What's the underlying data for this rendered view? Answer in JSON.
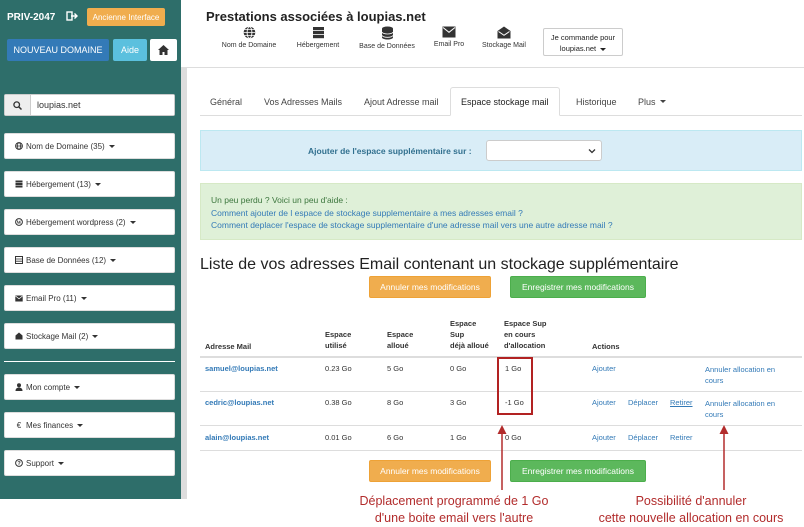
{
  "sidebar": {
    "priv_label": "PRIV-2047",
    "ancienne_label": "Ancienne Interface",
    "nouveau_label": "NOUVEAU DOMAINE",
    "aide_label": "Aide",
    "search_value": "loupias.net",
    "items": [
      {
        "label": "Nom de Domaine (35)",
        "icon": "globe-icon"
      },
      {
        "label": "Hébergement (13)",
        "icon": "server-icon"
      },
      {
        "label": "Hébergement wordpress (2)",
        "icon": "wordpress-icon"
      },
      {
        "label": "Base de Données (12)",
        "icon": "database-icon"
      },
      {
        "label": "Email Pro (11)",
        "icon": "envelope-icon"
      },
      {
        "label": "Stockage Mail (2)",
        "icon": "mail-storage-icon"
      },
      {
        "label": "Mon compte",
        "icon": "user-icon"
      },
      {
        "label": "Mes finances",
        "icon": "euro-icon"
      },
      {
        "label": "Support",
        "icon": "question-icon"
      }
    ]
  },
  "header": {
    "title": "Prestations associées à loupias.net",
    "nav": [
      {
        "label": "Nom de Domaine",
        "icon": "globe-icon"
      },
      {
        "label": "Hébergement",
        "icon": "server-icon"
      },
      {
        "label": "Base de Données",
        "icon": "database-icon"
      },
      {
        "label": "Email Pro",
        "icon": "envelope-icon"
      },
      {
        "label": "Stockage Mail",
        "icon": "mail-storage-icon"
      }
    ],
    "commande_line1": "Je commande pour",
    "commande_line2": "loupias.net"
  },
  "tabs": [
    "Général",
    "Vos Adresses Mails",
    "Ajout Adresse mail",
    "Espace stockage mail",
    "Historique",
    "Plus"
  ],
  "active_tab": "Espace stockage mail",
  "espace": {
    "label": "Ajouter de l'espace supplémentaire sur :",
    "selected": ""
  },
  "aide": {
    "intro": "Un peu perdu ? Voici un peu d'aide :",
    "link1": "Comment ajouter de l espace de stockage supplementaire a mes adresses email ?",
    "link2": "Comment deplacer l'espace de stockage supplementaire d'une adresse mail vers une autre adresse mail ?"
  },
  "list_title": "Liste de vos adresses Email contenant un stockage supplémentaire",
  "buttons": {
    "annuler": "Annuler mes modifications",
    "enregistrer": "Enregistrer mes modifications"
  },
  "table": {
    "headers": {
      "adresse": "Adresse Mail",
      "utilise": [
        "Espace",
        "utilisé"
      ],
      "alloue": [
        "Espace",
        "alloué"
      ],
      "deja": [
        "Espace",
        "Sup",
        "déjà alloué"
      ],
      "encours": [
        "Espace Sup",
        "en cours",
        "d'allocation"
      ],
      "actions": "Actions"
    },
    "rows": [
      {
        "email": "samuel@loupias.net",
        "utilise": "0.23 Go",
        "alloue": "5 Go",
        "deja": "0 Go",
        "encours": "1 Go",
        "ajouter": "Ajouter",
        "deplacer": "",
        "retirer": "",
        "annuler": [
          "Annuler allocation en",
          "cours"
        ]
      },
      {
        "email": "cedric@loupias.net",
        "utilise": "0.38 Go",
        "alloue": "8 Go",
        "deja": "3 Go",
        "encours": "-1 Go",
        "ajouter": "Ajouter",
        "deplacer": "Déplacer",
        "retirer": "Retirer",
        "annuler": [
          "Annuler allocation en",
          "cours"
        ]
      },
      {
        "email": "alain@loupias.net",
        "utilise": "0.01 Go",
        "alloue": "6 Go",
        "deja": "1 Go",
        "encours": "0 Go",
        "ajouter": "Ajouter",
        "deplacer": "Déplacer",
        "retirer": "Retirer",
        "annuler": [
          "",
          ""
        ]
      }
    ]
  },
  "annotations": {
    "left": [
      "Déplacement programmé de 1 Go",
      "d'une boite email vers l'autre"
    ],
    "right": [
      "Possibilité d'annuler",
      "cette nouvelle allocation en cours"
    ]
  },
  "colors": {
    "sidebar": "#2e6e6a",
    "annotation": "#b22c2c",
    "primary": "#337ab7"
  }
}
